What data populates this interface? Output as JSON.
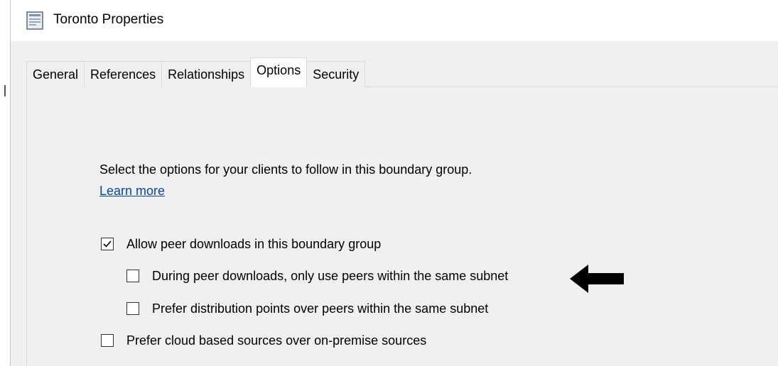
{
  "window": {
    "title": "Toronto Properties",
    "icon": "properties-window-icon"
  },
  "tabs": [
    {
      "label": "General",
      "active": false
    },
    {
      "label": "References",
      "active": false
    },
    {
      "label": "Relationships",
      "active": false
    },
    {
      "label": "Options",
      "active": true
    },
    {
      "label": "Security",
      "active": false
    }
  ],
  "options_panel": {
    "description": "Select the options for your clients to follow in this boundary group.",
    "learn_more": "Learn more",
    "checkboxes": [
      {
        "label": "Allow peer downloads in this boundary group",
        "checked": true
      },
      {
        "label": "During peer downloads, only use peers within the same subnet",
        "checked": false
      },
      {
        "label": "Prefer distribution points over peers within the same subnet",
        "checked": false
      },
      {
        "label": "Prefer cloud based sources over on-premise sources",
        "checked": false
      }
    ]
  },
  "annotation": {
    "arrow_icon": "left-arrow-icon",
    "color": "#000000"
  }
}
